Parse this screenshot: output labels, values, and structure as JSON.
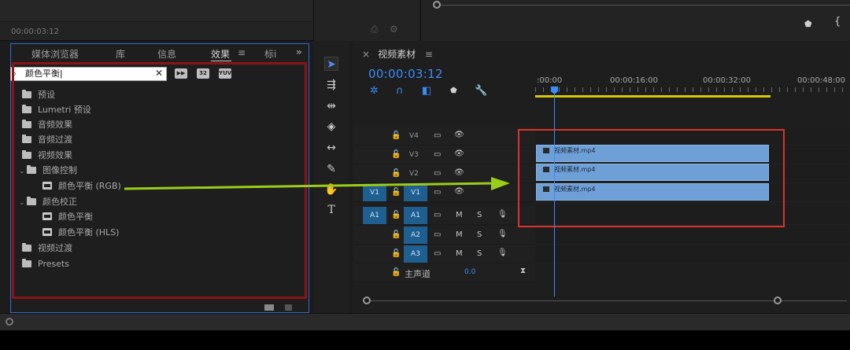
{
  "top": {
    "timecode": "00:00:03:12"
  },
  "effects_panel": {
    "tabs": [
      "媒体浏览器",
      "库",
      "信息",
      "效果",
      "标i"
    ],
    "active_tab": "效果",
    "tab_menu": "≡",
    "overflow": "»",
    "search": {
      "value": "颜色平衡",
      "placeholder": ""
    },
    "tree": [
      {
        "label": "预设",
        "type": "folder-fx",
        "indent": 0
      },
      {
        "label": "Lumetri 预设",
        "type": "folder-fx",
        "indent": 0
      },
      {
        "label": "音频效果",
        "type": "folder",
        "indent": 0
      },
      {
        "label": "音频过渡",
        "type": "folder",
        "indent": 0
      },
      {
        "label": "视频效果",
        "type": "folder",
        "indent": 0
      },
      {
        "label": "图像控制",
        "type": "folder",
        "indent": 1,
        "expanded": true
      },
      {
        "label": "颜色平衡 (RGB)",
        "type": "effect",
        "indent": 2
      },
      {
        "label": "颜色校正",
        "type": "folder",
        "indent": 1,
        "expanded": true
      },
      {
        "label": "颜色平衡",
        "type": "effect",
        "indent": 2
      },
      {
        "label": "颜色平衡 (HLS)",
        "type": "effect",
        "indent": 2
      },
      {
        "label": "视频过渡",
        "type": "folder",
        "indent": 0
      },
      {
        "label": "Presets",
        "type": "folder",
        "indent": 0
      }
    ],
    "fx_buttons": [
      "▶▶",
      "32",
      "YUV"
    ]
  },
  "timeline": {
    "tab_close": "×",
    "sequence_name": "视频素材",
    "tab_menu": "≡",
    "timecode": "00:00:03:12",
    "ruler": [
      ":00:00",
      "00:00:16:00",
      "00:00:32:00",
      "00:00:48:00"
    ],
    "tracks_video": [
      {
        "name": "V4",
        "src": ""
      },
      {
        "name": "V3",
        "src": ""
      },
      {
        "name": "V2",
        "src": ""
      },
      {
        "name": "V1",
        "src": "V1"
      }
    ],
    "tracks_audio": [
      {
        "name": "A1",
        "src": "A1"
      },
      {
        "name": "A2",
        "src": ""
      },
      {
        "name": "A3",
        "src": ""
      }
    ],
    "master": {
      "label": "主声道",
      "value": "0.0"
    },
    "clips": [
      "视频素材.mp4",
      "视频素材.mp4",
      "视频素材.mp4"
    ],
    "mute": "M",
    "solo": "S"
  },
  "colors": {
    "accent": "#3b8cff",
    "clip": "#6e9fd6",
    "highlight_red": "#d9332e",
    "arrow": "#9acd1a"
  }
}
